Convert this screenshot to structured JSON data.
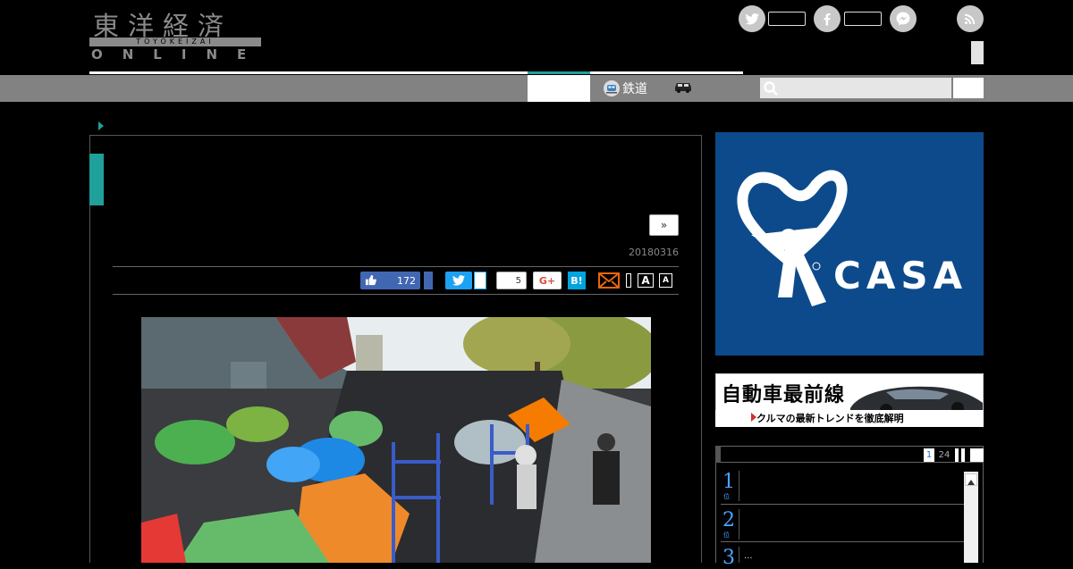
{
  "header": {
    "logo_kanji": "東洋経済",
    "logo_sub": "TOYOKEIZAI",
    "logo_online": "ONLINE"
  },
  "social": [
    {
      "icon": "twitter-icon"
    },
    {
      "icon": "facebook-icon"
    },
    {
      "icon": "messenger-icon"
    },
    {
      "icon": "rss-icon"
    }
  ],
  "nav": {
    "railway_label": "鉄道",
    "railway_icon": "train-icon",
    "car_icon": "car-icon",
    "search_placeholder": ""
  },
  "article": {
    "next_label": "»",
    "date": "20180316",
    "share": {
      "facebook_count": "172",
      "hatena_label": "B!",
      "google_label": "G+",
      "comment_count": "5",
      "font_large": "A",
      "font_small": "A"
    }
  },
  "sidebar": {
    "ad1_text": "CASA",
    "ad2_title": "自動車最前線",
    "ad2_sub": "クルマの最新トレンドを徹底解明",
    "ranking": {
      "tabs": [
        "1",
        "24"
      ],
      "items": [
        {
          "rank": "1",
          "sub": "位",
          "title": ""
        },
        {
          "rank": "2",
          "sub": "位",
          "title": ""
        },
        {
          "rank": "3",
          "sub": "位",
          "title": "..."
        }
      ]
    }
  },
  "colors": {
    "accent": "#1fa09a",
    "nav_bg": "#828282",
    "casa_blue": "#0d4a8b",
    "facebook": "#4267b2",
    "twitter": "#1da1f2"
  }
}
